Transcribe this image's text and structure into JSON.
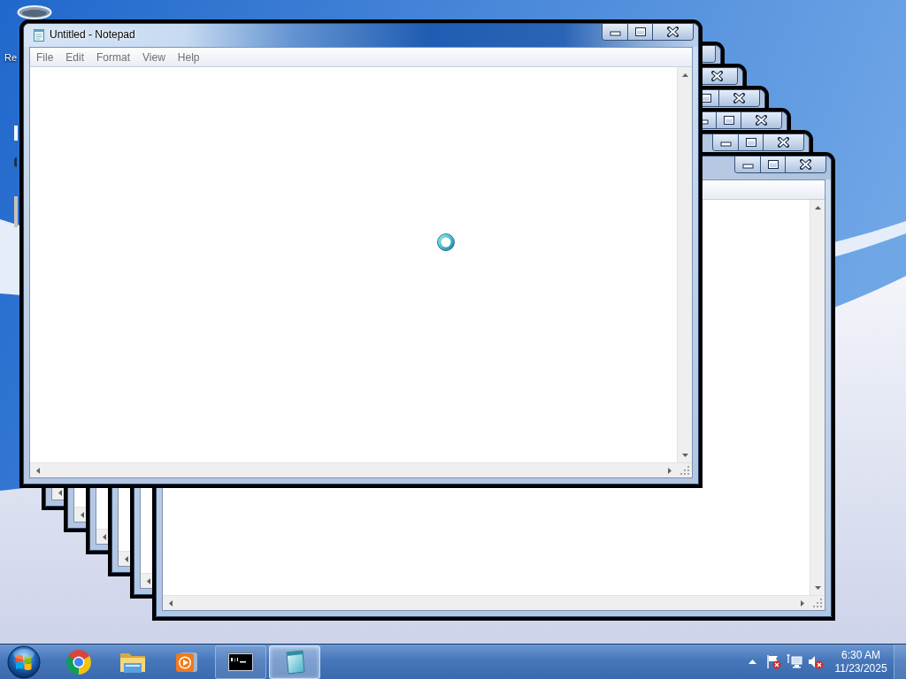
{
  "desktop": {
    "icons": [
      {
        "label": "Re"
      }
    ]
  },
  "windows": [
    {
      "title": "Untitled - Notepad",
      "active": true,
      "menu": [
        "File",
        "Edit",
        "Format",
        "View",
        "Help"
      ]
    },
    {
      "active": false
    },
    {
      "active": false
    },
    {
      "active": false
    },
    {
      "active": false
    },
    {
      "active": false
    },
    {
      "active": false
    }
  ],
  "taskbar": {
    "apps": [
      {
        "kind": "browser",
        "open": false,
        "selected": false
      },
      {
        "kind": "folder",
        "open": false,
        "selected": false
      },
      {
        "kind": "player",
        "open": false,
        "selected": false
      },
      {
        "kind": "terminal",
        "open": true,
        "selected": false
      },
      {
        "kind": "notepad",
        "open": true,
        "selected": true
      }
    ],
    "clock": {
      "time": "6:30 AM",
      "date": "11/23/2025"
    }
  }
}
